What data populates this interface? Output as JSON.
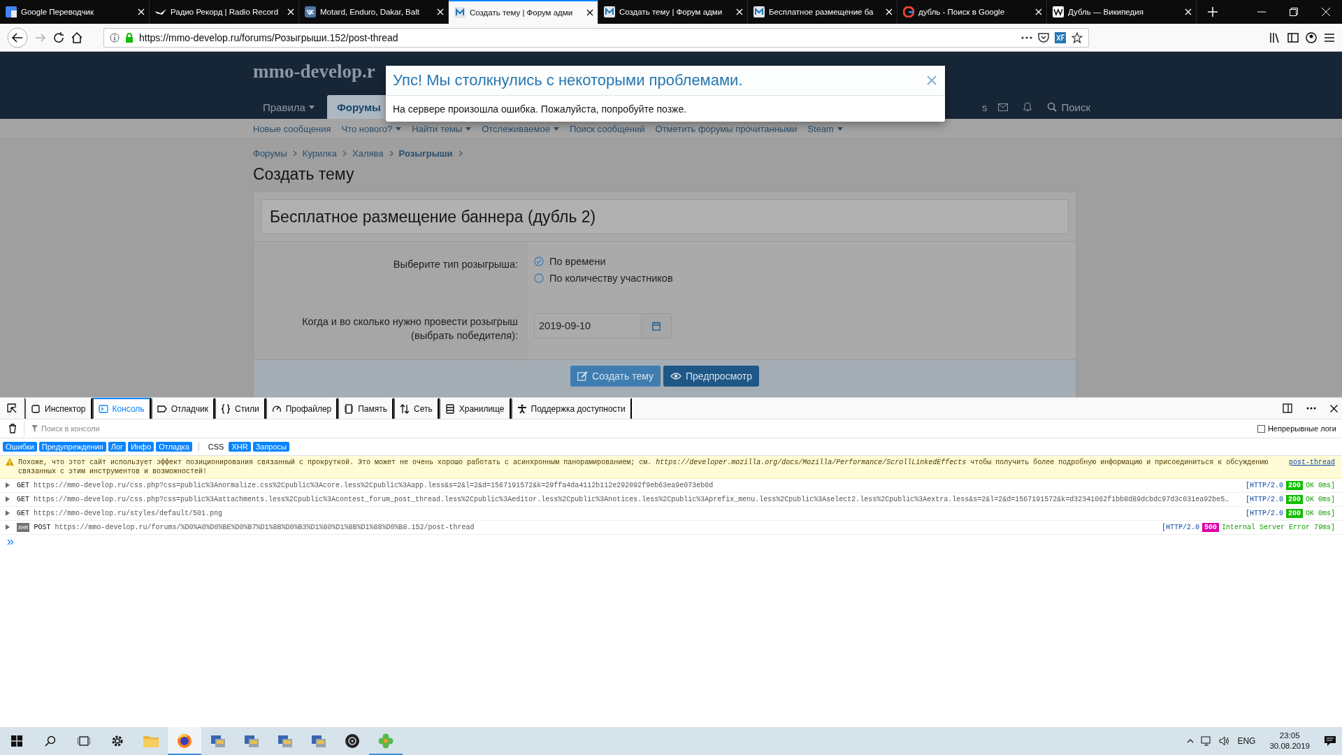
{
  "browser": {
    "tabs": [
      {
        "title": "Google Переводчик",
        "kind": "translate",
        "selected": false
      },
      {
        "title": "Радио Рекорд | Radio Record",
        "kind": "radio",
        "selected": false
      },
      {
        "title": "Motard, Enduro, Dakar, Balt",
        "kind": "vk",
        "selected": false
      },
      {
        "title": "Создать тему | Форум адми",
        "kind": "forum",
        "selected": true
      },
      {
        "title": "Создать тему | Форум адми",
        "kind": "forum",
        "selected": false
      },
      {
        "title": "Бесплатное размещение ба",
        "kind": "forum",
        "selected": false
      },
      {
        "title": "дубль - Поиск в Google",
        "kind": "google",
        "selected": false
      },
      {
        "title": "Дубль — Википедия",
        "kind": "wiki",
        "selected": false
      }
    ],
    "address": "https://mmo-develop.ru/forums/Розыгрыши.152/post-thread"
  },
  "forum": {
    "logo": "mmo-develop.r",
    "nav": [
      {
        "label": "Правила",
        "menu": true,
        "selected": false
      },
      {
        "label": "Форумы",
        "menu": false,
        "selected": true
      }
    ],
    "nav_fragment": "s",
    "search": "Поиск",
    "subnav": [
      {
        "label": "Новые сообщения",
        "menu": false
      },
      {
        "label": "Что нового?",
        "menu": true
      },
      {
        "label": "Найти темы",
        "menu": true
      },
      {
        "label": "Отслеживаемое",
        "menu": true
      },
      {
        "label": "Поиск сообщений",
        "menu": false
      },
      {
        "label": "Отметить форумы прочитанными",
        "menu": false
      },
      {
        "label": "Steam",
        "menu": true
      }
    ],
    "breadcrumbs": [
      {
        "label": "Форумы",
        "current": false
      },
      {
        "label": "Курилка",
        "current": false
      },
      {
        "label": "Халява",
        "current": false
      },
      {
        "label": "Розыгрыши",
        "current": true
      }
    ],
    "page_title": "Создать тему",
    "thread_title": "Бесплатное размещение баннера (дубль 2)",
    "type_label": "Выберите тип розыгрыша:",
    "type_options": [
      {
        "label": "По времени",
        "selected": true
      },
      {
        "label": "По количеству участников",
        "selected": false
      }
    ],
    "date_label": "Когда и во сколько нужно провести розыгрыш (выбрать победителя):",
    "date_value": "2019-09-10",
    "buttons": [
      {
        "label": "Создать тему",
        "kind": "primary"
      },
      {
        "label": "Предпросмотр",
        "kind": "secondary"
      }
    ],
    "dialog": {
      "title": "Упс! Мы столкнулись с некоторыми проблемами.",
      "message": "На сервере произошла ошибка. Пожалуйста, попробуйте позже."
    }
  },
  "devtools": {
    "tabs": [
      {
        "label": "Инспектор",
        "selected": false
      },
      {
        "label": "Консоль",
        "selected": true
      },
      {
        "label": "Отладчик",
        "selected": false
      },
      {
        "label": "Стили",
        "selected": false
      },
      {
        "label": "Профайлер",
        "selected": false
      },
      {
        "label": "Память",
        "selected": false
      },
      {
        "label": "Сеть",
        "selected": false
      },
      {
        "label": "Хранилище",
        "selected": false
      },
      {
        "label": "Поддержка доступности",
        "selected": false
      }
    ],
    "search": {
      "placeholder": "Поиск в консоли"
    },
    "persist_logs": {
      "label": "Непрерывные логи",
      "checked": false
    },
    "filters": [
      {
        "label": "Ошибки",
        "selected": true
      },
      {
        "label": "Предупреждения",
        "selected": true
      },
      {
        "label": "Лог",
        "selected": true
      },
      {
        "label": "Инфо",
        "selected": true
      },
      {
        "label": "Отладка",
        "selected": true
      },
      {
        "label": "CSS",
        "selected": false
      },
      {
        "label": "XHR",
        "selected": true
      },
      {
        "label": "Запросы",
        "selected": true
      }
    ],
    "messages": [
      {
        "kind": "warning",
        "text": "Похоже, что этот сайт использует эффект позиционирования связанный с прокруткой. Это может не очень хорошо работать с асинхронным панорамированием; см. *https://developer.mozilla.org/docs/Mozilla/Performance/ScrollLinkedEffects* чтобы получить более подробную информацию и присоединиться к обсуждению связанных с этим инструментов и возможностей!",
        "source": "post-thread"
      },
      {
        "kind": "request",
        "method": "GET",
        "url": "https://mmo-develop.ru/css.php?css=public%3Anormalize.css%2Cpublic%3Acore.less%2Cpublic%3Aapp.less&s=2&l=2&d=1567191572&k=29ffa4da4112b112e292092f9eb63ea9e073eb0d",
        "protocol": "[HTTP/2.0",
        "status": "200",
        "color": "#12bc00",
        "result": "OK 0ms]"
      },
      {
        "kind": "request",
        "method": "GET",
        "url": "https://mmo-develop.ru/css.php?css=public%3Aattachments.less%2Cpublic%3Acontest_forum_post_thread.less%2Cpublic%3Aeditor.less%2Cpublic%3Anotices.less%2Cpublic%3Aprefix_menu.less%2Cpublic%3Aselect2.less%2Cpublic%3Aextra.less&s=2&l=2&d=1567191572&k=d32341062f1bb8d89dcbdc97d3c031ea92be5…",
        "protocol": "[HTTP/2.0",
        "status": "200",
        "color": "#12bc00",
        "result": "OK 0ms]"
      },
      {
        "kind": "request",
        "method": "GET",
        "url": "https://mmo-develop.ru/styles/default/501.png",
        "protocol": "[HTTP/2.0",
        "status": "200",
        "color": "#12bc00",
        "result": "OK 0ms]"
      },
      {
        "kind": "request",
        "badge": "XHR",
        "method": "POST",
        "url": "https://mmo-develop.ru/forums/%D0%A0%D0%BE%D0%B7%D1%8B%D0%B3%D1%80%D1%8B%D1%88%D0%B8.152/post-thread",
        "protocol": "[HTTP/2.0",
        "status": "500",
        "color": "#dd00a9",
        "result": "Internal Server Error 79ms]"
      }
    ]
  },
  "taskbar": {
    "apps": [
      {
        "kind": "gear",
        "running": false,
        "selected": false
      },
      {
        "kind": "folder",
        "running": false,
        "selected": false
      },
      {
        "kind": "browser",
        "running": true,
        "selected": true
      },
      {
        "kind": "app",
        "running": false,
        "selected": false
      },
      {
        "kind": "app",
        "running": false,
        "selected": false
      },
      {
        "kind": "app",
        "running": false,
        "selected": false
      },
      {
        "kind": "app",
        "running": false,
        "selected": false
      },
      {
        "kind": "disc",
        "running": false,
        "selected": false
      },
      {
        "kind": "clover",
        "running": true,
        "selected": false
      }
    ],
    "language": "ENG",
    "time": "23:05",
    "date": "30.08.2019"
  }
}
